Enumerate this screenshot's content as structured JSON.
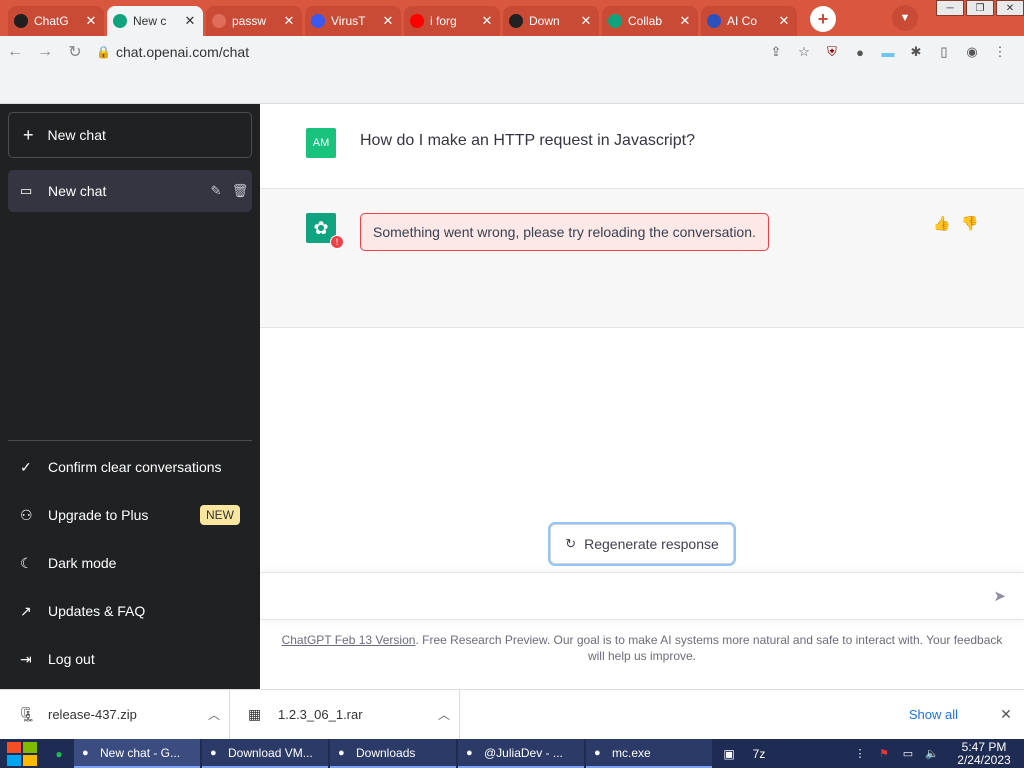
{
  "browser": {
    "tabs": [
      {
        "title": "ChatG",
        "favicon": "chatgpt-icon",
        "color": "#1f1f1f"
      },
      {
        "title": "New c",
        "favicon": "chatgpt-icon",
        "color": "#10a37f"
      },
      {
        "title": "passw",
        "favicon": "globe-icon",
        "color": "#e06c5a"
      },
      {
        "title": "VirusT",
        "favicon": "virustotal-icon",
        "color": "#3b58f0"
      },
      {
        "title": "i forg",
        "favicon": "youtube-icon",
        "color": "#ff0000"
      },
      {
        "title": "Down",
        "favicon": "lightning-icon",
        "color": "#222222"
      },
      {
        "title": "Collab",
        "favicon": "chatgpt-icon",
        "color": "#10a37f"
      },
      {
        "title": "AI Co",
        "favicon": "c-letter-icon",
        "color": "#2a52be"
      }
    ],
    "active_tab": 1,
    "close_glyph": "✕",
    "url": "chat.openai.com/chat"
  },
  "sidebar": {
    "new_chat_label": "New chat",
    "conversations": [
      {
        "label": "New chat"
      }
    ],
    "menu": [
      {
        "label": "Confirm clear conversations",
        "icon": "check-icon"
      },
      {
        "label": "Upgrade to Plus",
        "icon": "user-icon",
        "badge": "NEW"
      },
      {
        "label": "Dark mode",
        "icon": "moon-icon"
      },
      {
        "label": "Updates & FAQ",
        "icon": "external-link-icon"
      },
      {
        "label": "Log out",
        "icon": "logout-icon"
      }
    ]
  },
  "chat": {
    "user_initials": "AM",
    "user_message": "How do I make an HTTP request in Javascript?",
    "error_message": "Something went wrong, please try reloading the conversation.",
    "regenerate_label": "Regenerate response",
    "input_value": "",
    "footer_link": "ChatGPT Feb 13 Version",
    "footer_text": ". Free Research Preview. Our goal is to make AI systems more natural and safe to interact with. Your feedback will help us improve."
  },
  "downloads": {
    "items": [
      {
        "name": "release-437.zip"
      },
      {
        "name": "1.2.3_06_1.rar"
      }
    ],
    "show_all_label": "Show all"
  },
  "taskbar": {
    "apps": [
      {
        "label": "New chat - G...",
        "icon": "chrome-icon",
        "active": true
      },
      {
        "label": "Download VM...",
        "icon": "chrome-icon",
        "active": false
      },
      {
        "label": "Downloads",
        "icon": "folder-icon",
        "active": false
      },
      {
        "label": "@JuliaDev - ...",
        "icon": "discord-icon",
        "active": false
      },
      {
        "label": "mc.exe",
        "icon": "app-icon",
        "active": false
      }
    ],
    "time": "5:47 PM",
    "date": "2/24/2023"
  },
  "colors": {
    "accent": "#10a37f",
    "sidebar_bg": "#202123",
    "error_border": "#ef4146",
    "badge_bg": "#fae69e"
  }
}
